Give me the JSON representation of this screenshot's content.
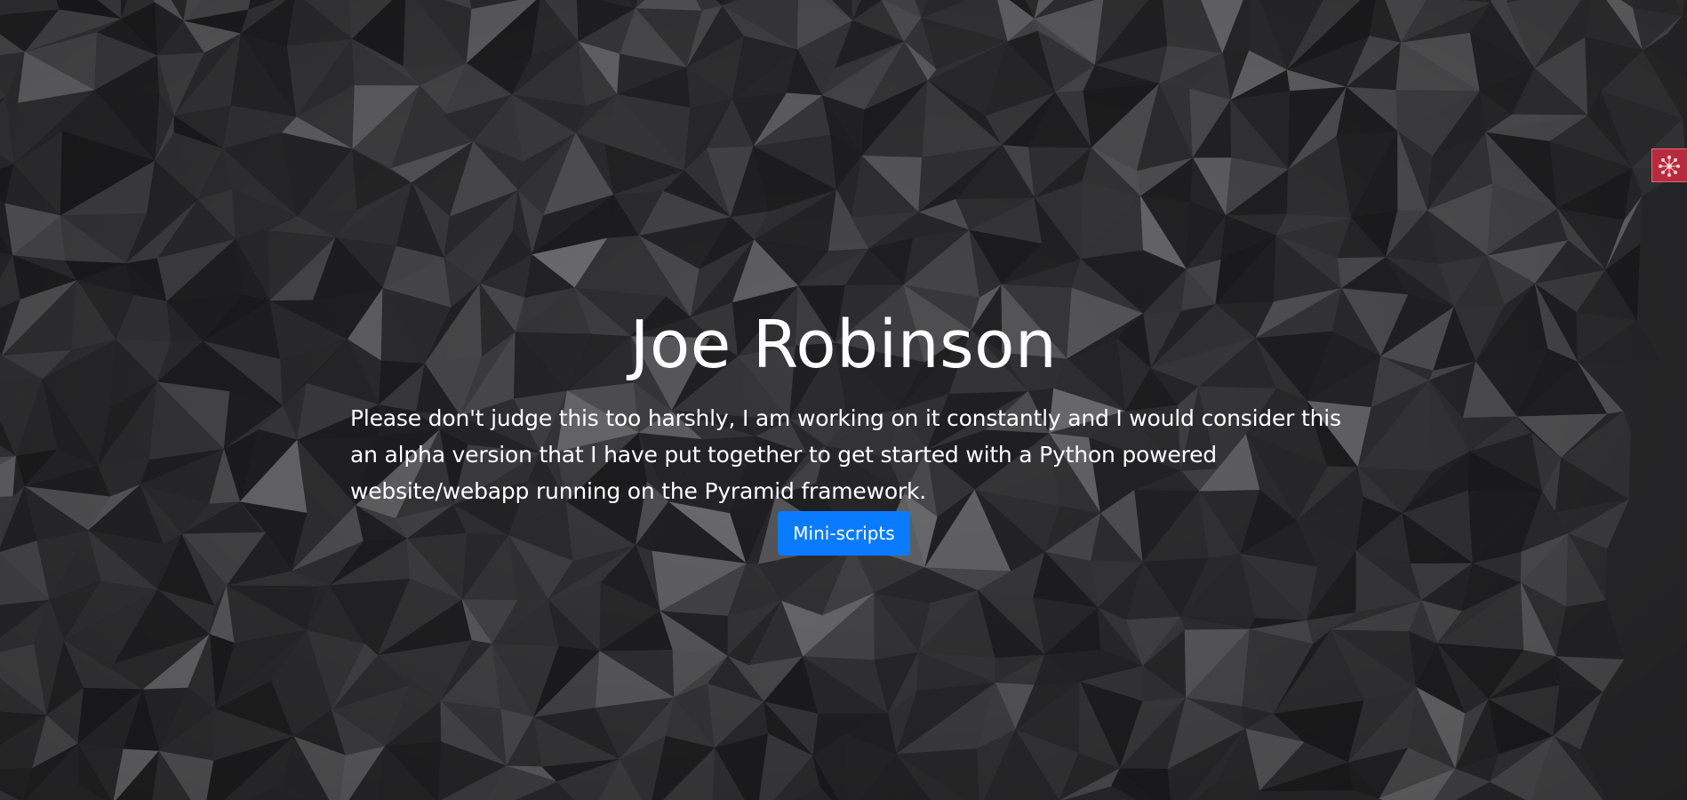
{
  "hero": {
    "title": "Joe Robinson",
    "paragraph": "Please don't judge this too harshly, I am working on it constantly and I would consider this an alpha version that I have put together to get started with a Python powered website/webapp running on the Pyramid framework.",
    "button_label": "Mini-scripts"
  },
  "side_badge": {
    "icon": "network-icon"
  },
  "colors": {
    "button": "#0a7bff",
    "badge": "#b82a3d",
    "text": "#ffffff"
  }
}
